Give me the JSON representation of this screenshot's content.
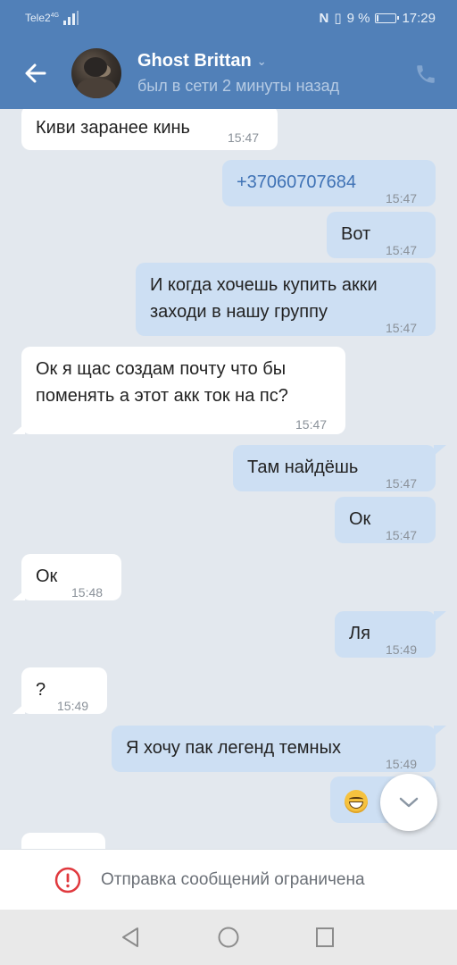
{
  "status_bar": {
    "carrier": "Tele2",
    "network": "4G",
    "battery_text": "9 %",
    "battery_level": 0.09,
    "time": "17:29"
  },
  "header": {
    "name": "Ghost Brittan",
    "last_seen": "был в сети 2 минуты назад",
    "icons": [
      "back-arrow-icon",
      "chevron-down-icon",
      "phone-icon"
    ]
  },
  "messages": [
    {
      "dir": "in",
      "text": "Киви заранее кинь",
      "time": "15:47"
    },
    {
      "dir": "out",
      "text": "+37060707684",
      "time": "15:47"
    },
    {
      "dir": "out",
      "text": "Вот",
      "time": "15:47"
    },
    {
      "dir": "out",
      "lines": [
        "И когда хочешь купить акки",
        "заходи в нашу группу"
      ],
      "time": "15:47"
    },
    {
      "dir": "in",
      "lines": [
        "Ок я щас создам почту что бы",
        "поменять а этот акк ток на пс?"
      ],
      "time": "15:47"
    },
    {
      "dir": "out",
      "text": "Там найдёшь",
      "time": "15:47"
    },
    {
      "dir": "out",
      "text": "Ок",
      "time": "15:47"
    },
    {
      "dir": "in",
      "text": "Ок",
      "time": "15:48"
    },
    {
      "dir": "out",
      "text": "Ля",
      "time": "15:49"
    },
    {
      "dir": "in",
      "text": "?",
      "time": "15:49"
    },
    {
      "dir": "out",
      "text": "Я хочу пак легенд темных",
      "time": "15:49"
    },
    {
      "dir": "out",
      "emoji": "grinning-face-icon"
    }
  ],
  "restricted": {
    "text": "Отправка сообщений ограничена",
    "icon": "warning-circle-icon"
  },
  "colors": {
    "header_bg": "#5180b8",
    "chat_bg": "#e3e8ee",
    "bubble_out": "#cddff3",
    "bubble_in": "#ffffff",
    "warning": "#e0393e",
    "link": "#3f72b5"
  }
}
